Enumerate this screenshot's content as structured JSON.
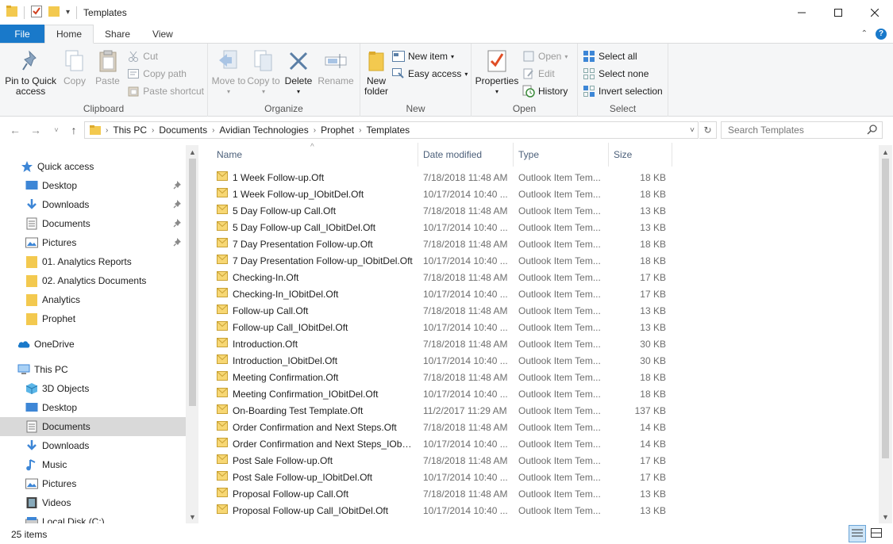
{
  "window": {
    "title": "Templates"
  },
  "tabs": [
    {
      "label": "File"
    },
    {
      "label": "Home"
    },
    {
      "label": "Share"
    },
    {
      "label": "View"
    }
  ],
  "ribbon": {
    "clipboard": {
      "label": "Clipboard",
      "pin": "Pin to Quick access",
      "copy": "Copy",
      "paste": "Paste",
      "cut": "Cut",
      "copy_path": "Copy path",
      "paste_shortcut": "Paste shortcut"
    },
    "organize": {
      "label": "Organize",
      "move_to": "Move to",
      "copy_to": "Copy to",
      "delete": "Delete",
      "rename": "Rename"
    },
    "new": {
      "label": "New",
      "new_folder": "New folder",
      "new_item": "New item",
      "easy_access": "Easy access"
    },
    "open": {
      "label": "Open",
      "properties": "Properties",
      "open": "Open",
      "edit": "Edit",
      "history": "History"
    },
    "select": {
      "label": "Select",
      "select_all": "Select all",
      "select_none": "Select none",
      "invert_selection": "Invert selection"
    }
  },
  "address": {
    "crumbs": [
      "This PC",
      "Documents",
      "Avidian Technologies",
      "Prophet",
      "Templates"
    ],
    "search_placeholder": "Search Templates"
  },
  "navpane": {
    "quick_access": "Quick access",
    "quick_items": [
      {
        "label": "Desktop",
        "icon": "desktop-icon",
        "pinned": true
      },
      {
        "label": "Downloads",
        "icon": "downloads-icon",
        "pinned": true
      },
      {
        "label": "Documents",
        "icon": "documents-icon",
        "pinned": true
      },
      {
        "label": "Pictures",
        "icon": "pictures-icon",
        "pinned": true
      },
      {
        "label": "01. Analytics Reports",
        "icon": "folder-icon",
        "pinned": false
      },
      {
        "label": "02. Analytics Documents",
        "icon": "folder-icon",
        "pinned": false
      },
      {
        "label": "Analytics",
        "icon": "folder-icon",
        "pinned": false
      },
      {
        "label": "Prophet",
        "icon": "folder-icon",
        "pinned": false
      }
    ],
    "onedrive": "OneDrive",
    "this_pc": "This PC",
    "pc_items": [
      {
        "label": "3D Objects",
        "icon": "3d-objects-icon"
      },
      {
        "label": "Desktop",
        "icon": "desktop-icon"
      },
      {
        "label": "Documents",
        "icon": "documents-icon",
        "selected": true
      },
      {
        "label": "Downloads",
        "icon": "downloads-icon"
      },
      {
        "label": "Music",
        "icon": "music-icon"
      },
      {
        "label": "Pictures",
        "icon": "pictures-icon"
      },
      {
        "label": "Videos",
        "icon": "videos-icon"
      },
      {
        "label": "Local Disk (C:)",
        "icon": "disk-icon"
      }
    ]
  },
  "columns": {
    "name": "Name",
    "date": "Date modified",
    "type": "Type",
    "size": "Size"
  },
  "files": [
    {
      "name": "1 Week Follow-up.Oft",
      "date": "7/18/2018 11:48 AM",
      "type": "Outlook Item Tem...",
      "size": "18 KB"
    },
    {
      "name": "1 Week Follow-up_IObitDel.Oft",
      "date": "10/17/2014 10:40 ...",
      "type": "Outlook Item Tem...",
      "size": "18 KB"
    },
    {
      "name": "5 Day Follow-up Call.Oft",
      "date": "7/18/2018 11:48 AM",
      "type": "Outlook Item Tem...",
      "size": "13 KB"
    },
    {
      "name": "5 Day Follow-up Call_IObitDel.Oft",
      "date": "10/17/2014 10:40 ...",
      "type": "Outlook Item Tem...",
      "size": "13 KB"
    },
    {
      "name": "7 Day Presentation Follow-up.Oft",
      "date": "7/18/2018 11:48 AM",
      "type": "Outlook Item Tem...",
      "size": "18 KB"
    },
    {
      "name": "7 Day Presentation Follow-up_IObitDel.Oft",
      "date": "10/17/2014 10:40 ...",
      "type": "Outlook Item Tem...",
      "size": "18 KB"
    },
    {
      "name": "Checking-In.Oft",
      "date": "7/18/2018 11:48 AM",
      "type": "Outlook Item Tem...",
      "size": "17 KB"
    },
    {
      "name": "Checking-In_IObitDel.Oft",
      "date": "10/17/2014 10:40 ...",
      "type": "Outlook Item Tem...",
      "size": "17 KB"
    },
    {
      "name": "Follow-up Call.Oft",
      "date": "7/18/2018 11:48 AM",
      "type": "Outlook Item Tem...",
      "size": "13 KB"
    },
    {
      "name": "Follow-up Call_IObitDel.Oft",
      "date": "10/17/2014 10:40 ...",
      "type": "Outlook Item Tem...",
      "size": "13 KB"
    },
    {
      "name": "Introduction.Oft",
      "date": "7/18/2018 11:48 AM",
      "type": "Outlook Item Tem...",
      "size": "30 KB"
    },
    {
      "name": "Introduction_IObitDel.Oft",
      "date": "10/17/2014 10:40 ...",
      "type": "Outlook Item Tem...",
      "size": "30 KB"
    },
    {
      "name": "Meeting Confirmation.Oft",
      "date": "7/18/2018 11:48 AM",
      "type": "Outlook Item Tem...",
      "size": "18 KB"
    },
    {
      "name": "Meeting Confirmation_IObitDel.Oft",
      "date": "10/17/2014 10:40 ...",
      "type": "Outlook Item Tem...",
      "size": "18 KB"
    },
    {
      "name": "On-Boarding Test Template.Oft",
      "date": "11/2/2017 11:29 AM",
      "type": "Outlook Item Tem...",
      "size": "137 KB"
    },
    {
      "name": "Order Confirmation and Next Steps.Oft",
      "date": "7/18/2018 11:48 AM",
      "type": "Outlook Item Tem...",
      "size": "14 KB"
    },
    {
      "name": "Order Confirmation and Next Steps_IObit...",
      "date": "10/17/2014 10:40 ...",
      "type": "Outlook Item Tem...",
      "size": "14 KB"
    },
    {
      "name": "Post Sale Follow-up.Oft",
      "date": "7/18/2018 11:48 AM",
      "type": "Outlook Item Tem...",
      "size": "17 KB"
    },
    {
      "name": "Post Sale Follow-up_IObitDel.Oft",
      "date": "10/17/2014 10:40 ...",
      "type": "Outlook Item Tem...",
      "size": "17 KB"
    },
    {
      "name": "Proposal Follow-up Call.Oft",
      "date": "7/18/2018 11:48 AM",
      "type": "Outlook Item Tem...",
      "size": "13 KB"
    },
    {
      "name": "Proposal Follow-up Call_IObitDel.Oft",
      "date": "10/17/2014 10:40 ...",
      "type": "Outlook Item Tem...",
      "size": "13 KB"
    }
  ],
  "status": {
    "count": "25 items"
  },
  "colors": {
    "accent": "#1979ca",
    "folder": "#f3c94f",
    "selected": "#d9d9d9"
  }
}
